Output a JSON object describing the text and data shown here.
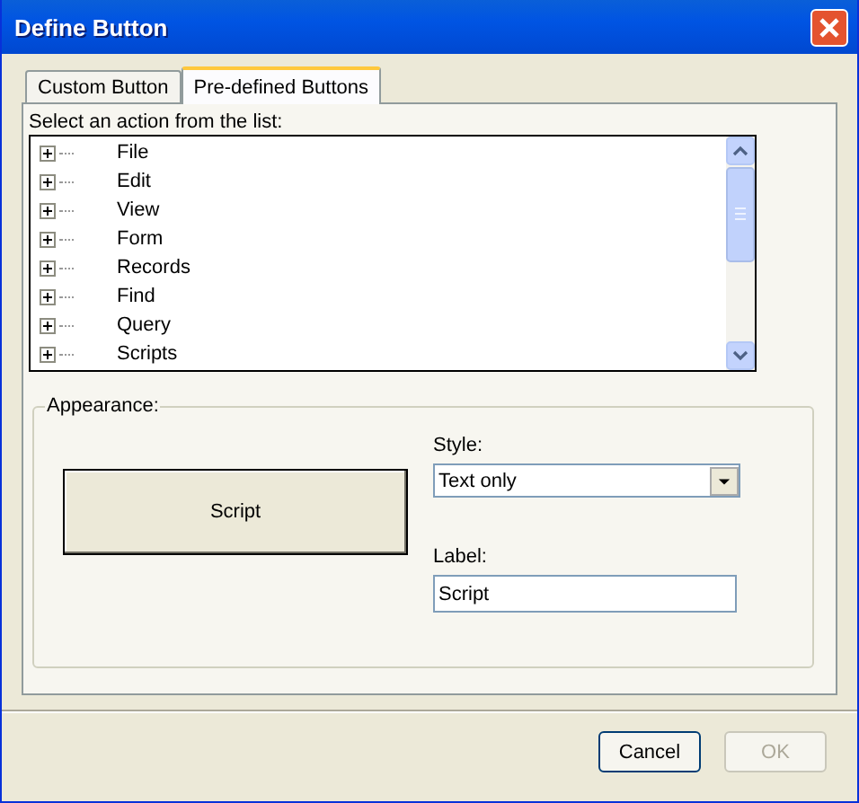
{
  "window": {
    "title": "Define Button"
  },
  "tabs": [
    {
      "label": "Custom Button",
      "selected": false
    },
    {
      "label": "Pre-defined Buttons",
      "selected": true
    }
  ],
  "action_list": {
    "label": "Select an action from the list:",
    "items": [
      {
        "label": "File",
        "expanded": false
      },
      {
        "label": "Edit",
        "expanded": false
      },
      {
        "label": "View",
        "expanded": false
      },
      {
        "label": "Form",
        "expanded": false
      },
      {
        "label": "Records",
        "expanded": false
      },
      {
        "label": "Find",
        "expanded": false
      },
      {
        "label": "Query",
        "expanded": false
      },
      {
        "label": "Scripts",
        "expanded": false
      }
    ]
  },
  "appearance": {
    "title": "Appearance:",
    "preview_button": "Script",
    "style_label": "Style:",
    "style_value": "Text only",
    "label_label": "Label:",
    "label_value": "Script"
  },
  "buttons": [
    {
      "label": "Cancel",
      "disabled": false
    },
    {
      "label": "OK",
      "disabled": true
    }
  ]
}
